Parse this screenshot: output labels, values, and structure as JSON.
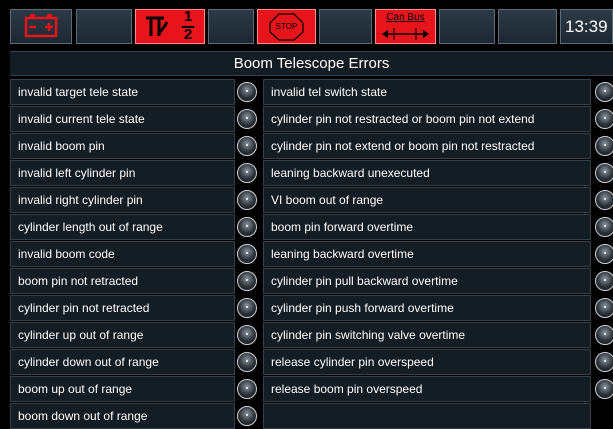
{
  "status_bar": {
    "clock": "13:39",
    "stop_label": "STOP",
    "can_bus_label": "Can Bus",
    "ratio_numerator": "1",
    "ratio_denominator": "2",
    "colors": {
      "alarm_red": "#e8141b",
      "panel": "#1d2731"
    },
    "icons": [
      "battery-icon",
      "telescope-half-icon",
      "stop-sign-icon",
      "can-bus-icon"
    ]
  },
  "title": "Boom Telescope Errors",
  "errors_left": [
    "invalid target tele state",
    "invalid current tele state",
    "invalid boom pin",
    "invalid left cylinder pin",
    "invalid right cylinder pin",
    "cylinder length out of range",
    "invalid boom code",
    "boom pin not retracted",
    "cylinder pin not retracted",
    "cylinder up out of range",
    "cylinder down out of range",
    "boom up out of range",
    "boom down out of range"
  ],
  "errors_right": [
    "invalid tel switch state",
    "cylinder pin not restracted or boom pin not extend",
    "cylinder pin not extend or boom pin not restracted",
    "leaning backward unexecuted",
    "VI boom out of range",
    "boom pin forward overtime",
    "leaning backward overtime",
    "cylinder pin pull backward overtime",
    "cylinder pin push forward overtime",
    "cylinder pin switching valve overtime",
    "release cylinder pin overspeed",
    "release boom pin overspeed"
  ]
}
